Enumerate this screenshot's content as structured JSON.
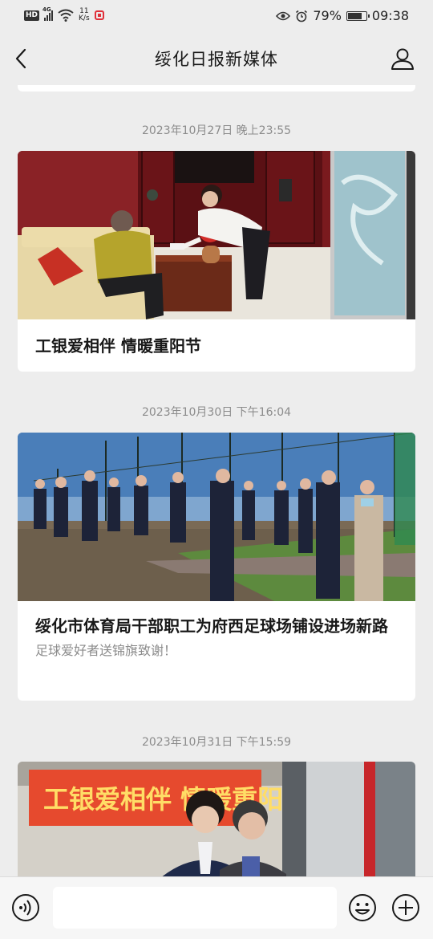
{
  "status_bar": {
    "hd": "HD",
    "network": "4G",
    "speed_value": "11",
    "speed_unit": "K/s",
    "battery_percent": "79%",
    "battery_level": 0.79,
    "time": "09:38"
  },
  "header": {
    "title": "绥化日报新媒体"
  },
  "articles": [
    {
      "timestamp": "2023年10月27日 晚上23:55",
      "title": "工银爱相伴 情暖重阳节",
      "desc": ""
    },
    {
      "timestamp": "2023年10月30日 下午16:04",
      "title": "绥化市体育局干部职工为府西足球场铺设进场新路",
      "desc": "足球爱好者送锦旗致谢！"
    },
    {
      "timestamp": "2023年10月31日 下午15:59",
      "title": "",
      "desc": "",
      "banner_text": "工银爱相伴 情暖重阳"
    }
  ],
  "input_bar": {
    "placeholder": ""
  },
  "icons": {
    "back": "back-arrow-icon",
    "profile": "person-icon",
    "voice": "voice-icon",
    "emoji": "smiley-icon",
    "plus": "plus-icon"
  },
  "colors": {
    "background": "#ededed",
    "card": "#ffffff",
    "timestamp": "#8c8c8c",
    "title": "#191919",
    "banner": "#e64a2e"
  }
}
